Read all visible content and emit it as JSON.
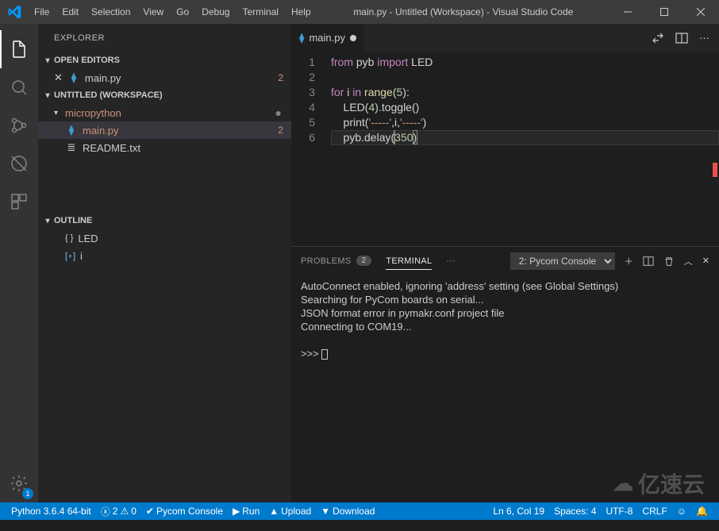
{
  "titlebar": {
    "menus": [
      "File",
      "Edit",
      "Selection",
      "View",
      "Go",
      "Debug",
      "Terminal",
      "Help"
    ],
    "title": "main.py - Untitled (Workspace) - Visual Studio Code"
  },
  "sidebar": {
    "title": "EXPLORER",
    "sections": {
      "open_editors": {
        "label": "OPEN EDITORS",
        "items": [
          {
            "name": "main.py",
            "unsaved": true,
            "badge": "2"
          }
        ]
      },
      "workspace": {
        "label": "UNTITLED (WORKSPACE)",
        "folder": "micropython",
        "files": [
          {
            "name": "main.py",
            "badge": "2",
            "selected": true
          },
          {
            "name": "README.txt"
          }
        ]
      },
      "outline": {
        "label": "OUTLINE",
        "items": [
          {
            "sym": "{ }",
            "name": "LED",
            "color": "#cccccc"
          },
          {
            "sym": "[∘]",
            "name": "i",
            "color": "#75beff"
          }
        ]
      }
    }
  },
  "editor": {
    "tab_name": "main.py",
    "gutter": [
      "1",
      "2",
      "3",
      "4",
      "5",
      "6"
    ],
    "code": {
      "l1": {
        "a": "from",
        "b": " pyb ",
        "c": "import",
        "d": " LED"
      },
      "l3": {
        "a": "for",
        "b": " i ",
        "c": "in",
        "d": " range",
        "e": "(",
        "f": "5",
        "g": "):"
      },
      "l4": {
        "a": "    LED(",
        "b": "4",
        "c": ").toggle()"
      },
      "l5": {
        "a": "    print(",
        "b": "'-----'",
        "c": ",i,",
        "d": "'-----'",
        "e": ")"
      },
      "l6": {
        "a": "    pyb.delay(",
        "b": "350",
        "c": ")"
      }
    }
  },
  "panel": {
    "tabs": {
      "problems": "PROBLEMS",
      "problems_count": "2",
      "terminal": "TERMINAL"
    },
    "selector": "2: Pycom Console",
    "lines": [
      "AutoConnect enabled, ignoring 'address' setting (see Global Settings)",
      "Searching for PyCom boards on serial...",
      "JSON format error in pymakr.conf project file",
      "Connecting to COM19..."
    ],
    "prompt": ">>> "
  },
  "statusbar": {
    "python": "Python 3.6.4 64-bit",
    "errors": "2",
    "warnings": "0",
    "console": "Pycom Console",
    "run": "Run",
    "upload": "Upload",
    "download": "Download",
    "position": "Ln 6, Col 19",
    "spaces": "Spaces: 4",
    "encoding": "UTF-8",
    "eol": "CRLF"
  },
  "gear_badge": "1",
  "watermark": "亿速云"
}
